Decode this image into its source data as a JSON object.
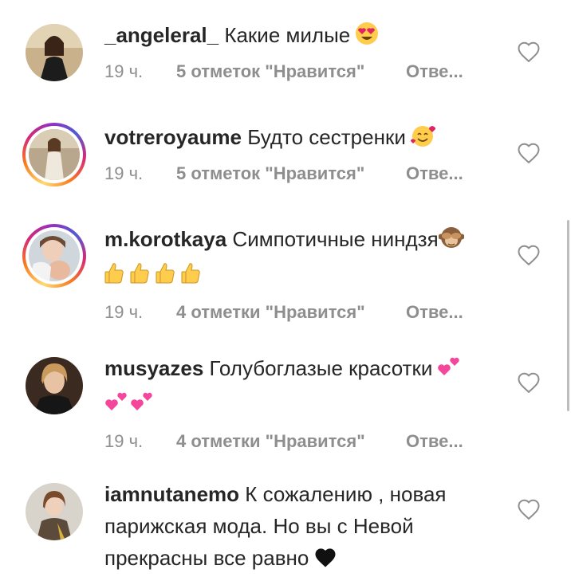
{
  "colors": {
    "username": "#262626",
    "text": "#262626",
    "meta": "#8e8e8e",
    "heart_outline": "#8e8e8e"
  },
  "comments": [
    {
      "username": "_angeleral_",
      "text": "Какие милые",
      "time": "19 ч.",
      "likes": "5 отметок \"Нравится\"",
      "reply": "Отве...",
      "emoji": [
        "heart-eyes"
      ],
      "has_story": false
    },
    {
      "username": "votreroyaume",
      "text": "Будто сестренки",
      "time": "19 ч.",
      "likes": "5 отметок \"Нравится\"",
      "reply": "Отве...",
      "emoji": [
        "smiling-face-with-hearts"
      ],
      "has_story": true
    },
    {
      "username": "m.korotkaya",
      "text": "Симпотичные ниндзя",
      "time": "19 ч.",
      "likes": "4 отметки \"Нравится\"",
      "reply": "Отве...",
      "emoji": [
        "see-no-evil-monkey",
        "thumbs-up",
        "thumbs-up",
        "thumbs-up",
        "thumbs-up"
      ],
      "has_story": true
    },
    {
      "username": "musyazes",
      "text": "Голубоглазые красотки",
      "time": "19 ч.",
      "likes": "4 отметки \"Нравится\"",
      "reply": "Отве...",
      "emoji": [
        "two-hearts",
        "two-hearts",
        "two-hearts"
      ],
      "has_story": false
    },
    {
      "username": "iamnutanemo",
      "text": "К сожалению , новая парижская мода. Но вы с Невой прекрасны все равно",
      "emoji": [
        "black-heart"
      ],
      "has_story": false
    }
  ]
}
